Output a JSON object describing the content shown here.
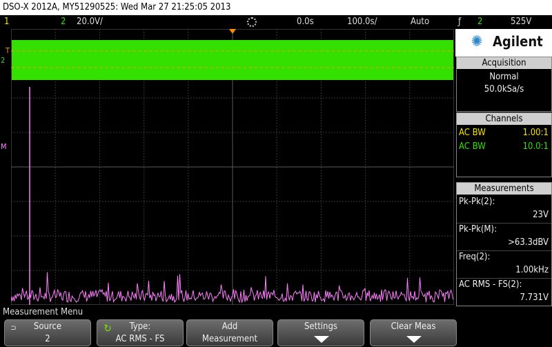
{
  "titlebar": {
    "text": "DSO-X 2012A, MY51290525: Wed Mar 27 21:25:05 2013"
  },
  "topbar": {
    "ch1": "1",
    "ch2": "2",
    "ch2_scale": "20.0V/",
    "time_pos": "0.0s",
    "time_scale": "100.0s/",
    "trigger_mode": "Auto",
    "trigger_slope": "ƒ",
    "trigger_ch": "2",
    "trigger_level": "525V"
  },
  "markers": {
    "t": "T",
    "ch2": "2",
    "m": "M"
  },
  "brand": {
    "name": "Agilent"
  },
  "acquisition": {
    "header": "Acquisition",
    "mode": "Normal",
    "rate": "50.0kSa/s"
  },
  "channels": {
    "header": "Channels",
    "rows": [
      {
        "label": "AC BW",
        "value": "1.00:1",
        "color": "#f4e400"
      },
      {
        "label": "AC BW",
        "value": "10.0:1",
        "color": "#33e000"
      }
    ]
  },
  "measurements": {
    "header": "Measurements",
    "items": [
      {
        "name": "Pk-Pk(2):",
        "value": "23V"
      },
      {
        "name": "Pk-Pk(M):",
        "value": ">63.3dBV"
      },
      {
        "name": "Freq(2):",
        "value": "1.00kHz"
      },
      {
        "name": "AC RMS - FS(2):",
        "value": "7.731V"
      }
    ]
  },
  "menu": {
    "title": "Measurement Menu",
    "softkeys": [
      {
        "line1": "Source",
        "line2": "2"
      },
      {
        "line1": "Type:",
        "line2": "AC RMS - FS"
      },
      {
        "line1": "Add",
        "line2": "Measurement"
      },
      {
        "line1": "Settings",
        "line2": ""
      },
      {
        "line1": "Clear Meas",
        "line2": ""
      }
    ]
  },
  "colors": {
    "ch1": "#f4e400",
    "ch2": "#33e000",
    "math": "#ff80ff",
    "grid": "#3a3a3a"
  }
}
